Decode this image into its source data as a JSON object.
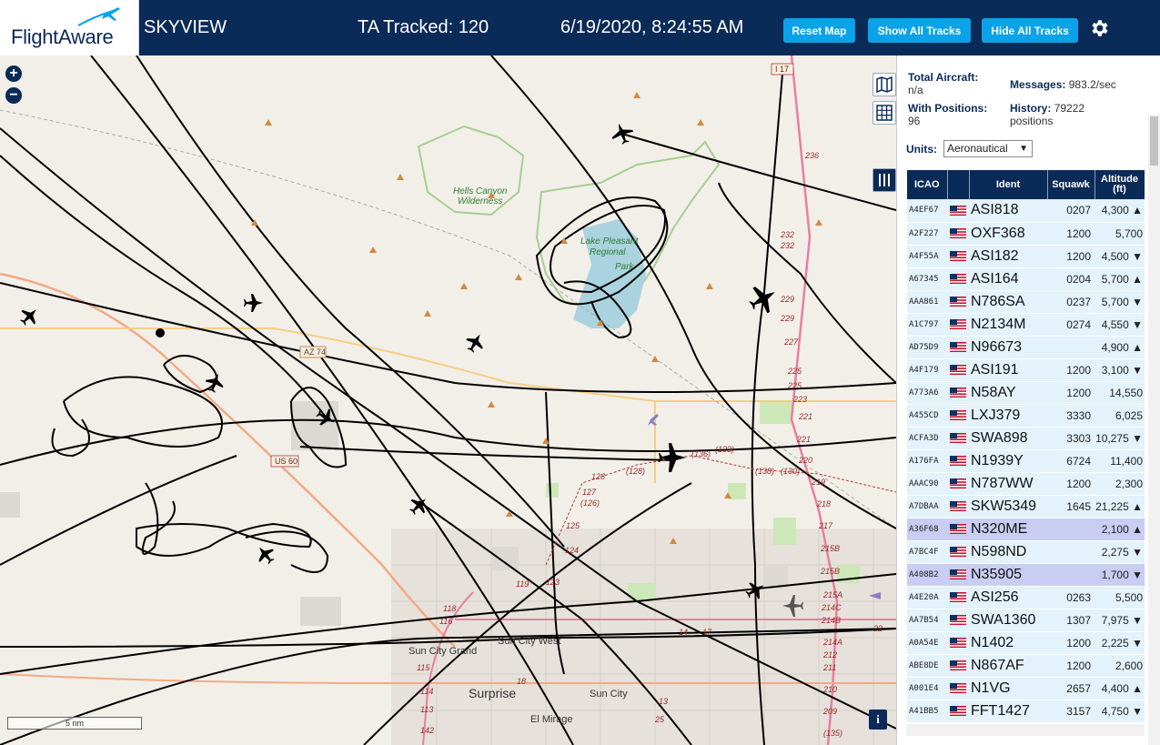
{
  "header": {
    "logo_text": "FlightAware",
    "app_title": "SKYVIEW",
    "ta_tracked": "TA Tracked: 120",
    "datetime": "6/19/2020, 8:24:55 AM",
    "buttons": {
      "reset_map": "Reset Map",
      "show_all_tracks": "Show All Tracks",
      "hide_all_tracks": "Hide All Tracks"
    },
    "settings_icon": "gear-icon"
  },
  "map": {
    "zoom_in": "+",
    "zoom_out": "−",
    "scale_label": "5 nm",
    "info_label": "i",
    "place_labels": {
      "hells_canyon": "Hells Canyon",
      "wilderness": "Wilderness",
      "lake_pleasant_1": "Lake Pleasant",
      "lake_pleasant_2": "Regional",
      "lake_pleasant_3": "Park",
      "sun_city_grand": "Sun City Grand",
      "sun_city_west": "Sun City West",
      "surprise": "Surprise",
      "sun_city": "Sun City",
      "el_mirage": "El Mirage"
    },
    "shields": {
      "az74": "AZ 74",
      "us60": "US 60",
      "i17": "I 17"
    },
    "mile_markers": [
      "236",
      "232",
      "232",
      "229",
      "229",
      "227",
      "225",
      "225",
      "223",
      "221",
      "221",
      "220",
      "219",
      "218",
      "217",
      "215B",
      "215B",
      "215A",
      "214C",
      "214B",
      "214A",
      "212",
      "211",
      "210",
      "209",
      "(135)",
      "(133)",
      "(136)",
      "(138)",
      "(130)",
      "(128)",
      "128",
      "127",
      "(126)",
      "125",
      "124",
      "123",
      "119",
      "118",
      "116",
      "115",
      "114",
      "113",
      "142",
      "18",
      "17",
      "14",
      "13",
      "25",
      "22"
    ]
  },
  "panel": {
    "total_aircraft_label": "Total Aircraft:",
    "total_aircraft_value": "n/a",
    "with_positions_label": "With Positions:",
    "with_positions_value": "96",
    "messages_label": "Messages:",
    "messages_value": "983.2/sec",
    "history_label": "History:",
    "history_value": "79222",
    "history_unit": "positions",
    "units_label": "Units:",
    "units_value": "Aeronautical",
    "columns": [
      "ICAO",
      "",
      "Ident",
      "Squawk",
      "Altitude (ft)"
    ],
    "rows": [
      {
        "icao": "A4EF67",
        "ident": "ASI818",
        "squawk": "0207",
        "alt": "4,300 ▲",
        "sel": false
      },
      {
        "icao": "A2F227",
        "ident": "OXF368",
        "squawk": "1200",
        "alt": "5,700",
        "sel": false
      },
      {
        "icao": "A4F55A",
        "ident": "ASI182",
        "squawk": "1200",
        "alt": "4,500 ▼",
        "sel": false
      },
      {
        "icao": "A67345",
        "ident": "ASI164",
        "squawk": "0204",
        "alt": "5,700 ▲",
        "sel": false
      },
      {
        "icao": "AAA861",
        "ident": "N786SA",
        "squawk": "0237",
        "alt": "5,700 ▼",
        "sel": false
      },
      {
        "icao": "A1C797",
        "ident": "N2134M",
        "squawk": "0274",
        "alt": "4,550 ▼",
        "sel": false
      },
      {
        "icao": "AD75D9",
        "ident": "N96673",
        "squawk": "",
        "alt": "4,900 ▲",
        "sel": false
      },
      {
        "icao": "A4F179",
        "ident": "ASI191",
        "squawk": "1200",
        "alt": "3,100 ▼",
        "sel": false
      },
      {
        "icao": "A773A6",
        "ident": "N58AY",
        "squawk": "1200",
        "alt": "14,550",
        "sel": false
      },
      {
        "icao": "A455CD",
        "ident": "LXJ379",
        "squawk": "3330",
        "alt": "6,025",
        "sel": false
      },
      {
        "icao": "ACFA3D",
        "ident": "SWA898",
        "squawk": "3303",
        "alt": "10,275 ▼",
        "sel": false
      },
      {
        "icao": "A176FA",
        "ident": "N1939Y",
        "squawk": "6724",
        "alt": "11,400",
        "sel": false
      },
      {
        "icao": "AAAC90",
        "ident": "N787WW",
        "squawk": "1200",
        "alt": "2,300",
        "sel": false
      },
      {
        "icao": "A7DBAA",
        "ident": "SKW5349",
        "squawk": "1645",
        "alt": "21,225 ▲",
        "sel": false
      },
      {
        "icao": "A36F68",
        "ident": "N320ME",
        "squawk": "",
        "alt": "2,100 ▲",
        "sel": true
      },
      {
        "icao": "A7BC4F",
        "ident": "N598ND",
        "squawk": "",
        "alt": "2,275 ▼",
        "sel": false
      },
      {
        "icao": "A408B2",
        "ident": "N35905",
        "squawk": "",
        "alt": "1,700 ▼",
        "sel": true
      },
      {
        "icao": "A4E20A",
        "ident": "ASI256",
        "squawk": "0263",
        "alt": "5,500",
        "sel": false
      },
      {
        "icao": "AA7B54",
        "ident": "SWA1360",
        "squawk": "1307",
        "alt": "7,975 ▼",
        "sel": false
      },
      {
        "icao": "A0A54E",
        "ident": "N1402",
        "squawk": "1200",
        "alt": "2,225 ▼",
        "sel": false
      },
      {
        "icao": "ABE8DE",
        "ident": "N867AF",
        "squawk": "1200",
        "alt": "2,600",
        "sel": false
      },
      {
        "icao": "A001E4",
        "ident": "N1VG",
        "squawk": "2657",
        "alt": "4,400 ▲",
        "sel": false
      },
      {
        "icao": "A41BB5",
        "ident": "FFT1427",
        "squawk": "3157",
        "alt": "4,750 ▼",
        "sel": false
      }
    ]
  },
  "colors": {
    "header_bg": "#0a2a57",
    "button_bg": "#0aa3e8",
    "row_bg": "#e3f2fb",
    "row_selected_bg": "#c9cdf2",
    "map_bg": "#f2efe9",
    "lake": "#abd3df",
    "park_outline": "#a6cf8f"
  }
}
